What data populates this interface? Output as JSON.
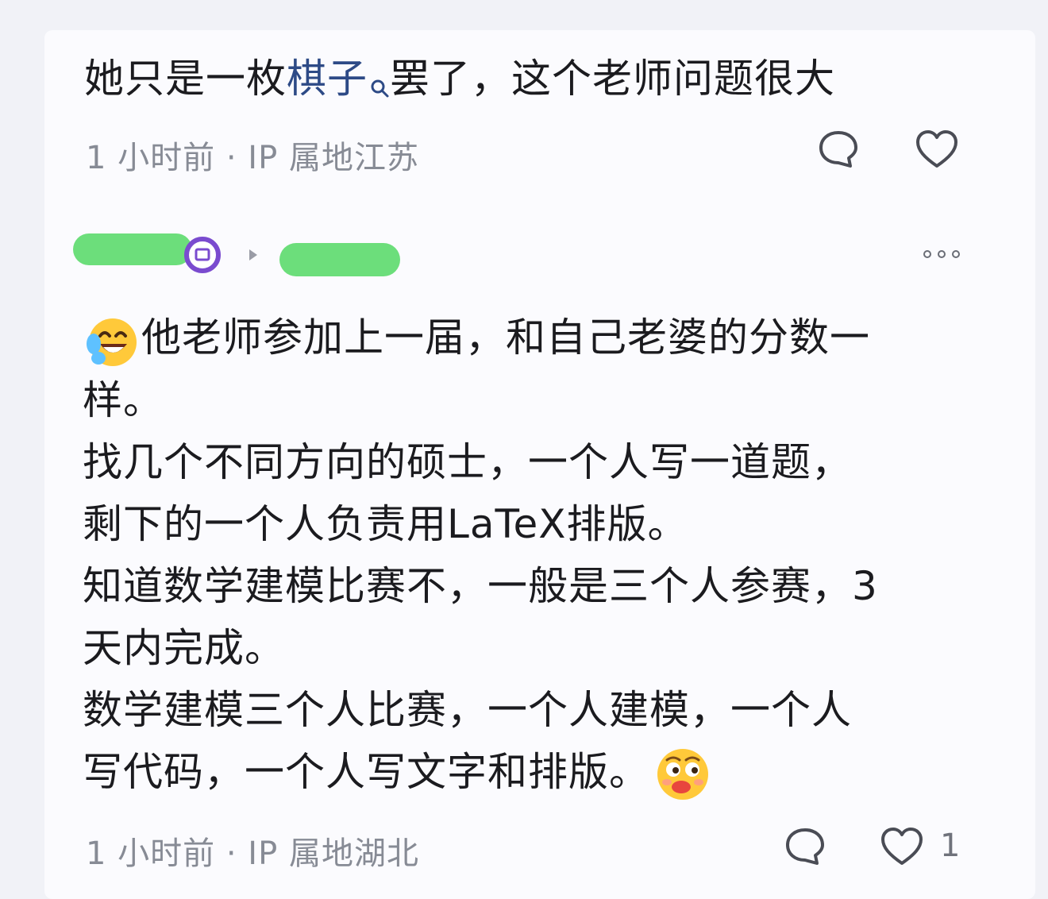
{
  "comment1": {
    "text_prefix": "她只是一枚",
    "keyword": "棋子",
    "text_suffix": "罢了，这个老师问题很大",
    "meta": "1 小时前 · IP 属地江苏",
    "icons": [
      "comment-icon",
      "like-icon"
    ]
  },
  "comment2": {
    "header_icons": [
      "avatar-badge-icon",
      "reply-arrow-icon",
      "more-icon"
    ],
    "emoji_start": "laughing-emoji",
    "lines": [
      "他老师参加上一届，和自己老婆的分数一",
      "样。",
      "找几个不同方向的硕士，一个人写一道题，",
      "剩下的一个人负责用LaTeX排版。",
      "知道数学建模比赛不，一般是三个人参赛，3",
      "天内完成。",
      "数学建模三个人比赛，一个人建模，一个人",
      "写代码，一个人写文字和排版。"
    ],
    "emoji_end": "smirk-emoji",
    "meta": "1 小时前 · IP 属地湖北",
    "like_count": "1",
    "colors": {
      "redaction": "#64dc74",
      "keyword": "#2d4a86",
      "meta": "#878b95"
    }
  }
}
